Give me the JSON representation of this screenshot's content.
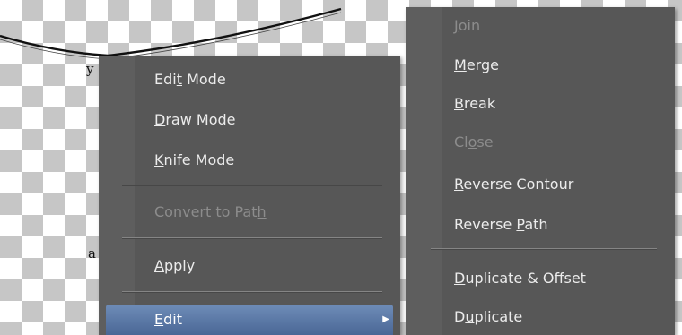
{
  "context_menu": {
    "items": [
      {
        "pre": "Edi",
        "key": "t",
        "post": " Mode",
        "enabled": true
      },
      {
        "pre": "",
        "key": "D",
        "post": "raw Mode",
        "enabled": true
      },
      {
        "pre": "",
        "key": "K",
        "post": "nife Mode",
        "enabled": true
      },
      {
        "pre": "Convert to Pat",
        "key": "h",
        "post": "",
        "enabled": false
      },
      {
        "pre": "",
        "key": "A",
        "post": "pply",
        "enabled": true
      },
      {
        "pre": "",
        "key": "E",
        "post": "dit",
        "enabled": true,
        "highlighted": true
      }
    ],
    "submenu_arrow": "▶"
  },
  "edit_submenu": {
    "items": [
      {
        "pre": "",
        "key": "J",
        "post": "oin",
        "enabled": false
      },
      {
        "pre": "",
        "key": "M",
        "post": "erge",
        "enabled": true
      },
      {
        "pre": "",
        "key": "B",
        "post": "reak",
        "enabled": true
      },
      {
        "pre": "Cl",
        "key": "o",
        "post": "se",
        "enabled": false
      },
      {
        "pre": "",
        "key": "R",
        "post": "everse Contour",
        "enabled": true
      },
      {
        "pre": "Reverse ",
        "key": "P",
        "post": "ath",
        "enabled": true
      },
      {
        "pre": "",
        "key": "D",
        "post": "uplicate & Offset",
        "enabled": true
      },
      {
        "pre": "D",
        "key": "u",
        "post": "plicate",
        "enabled": true
      }
    ]
  },
  "canvas": {
    "background": "transparency-checkerboard",
    "edge_glyphs": [
      "y",
      "a"
    ]
  },
  "colors": {
    "menu_bg": "#575757",
    "menu_text": "#ececec",
    "disabled_text": "#8c8c8c",
    "highlight": "#5a78a8"
  }
}
